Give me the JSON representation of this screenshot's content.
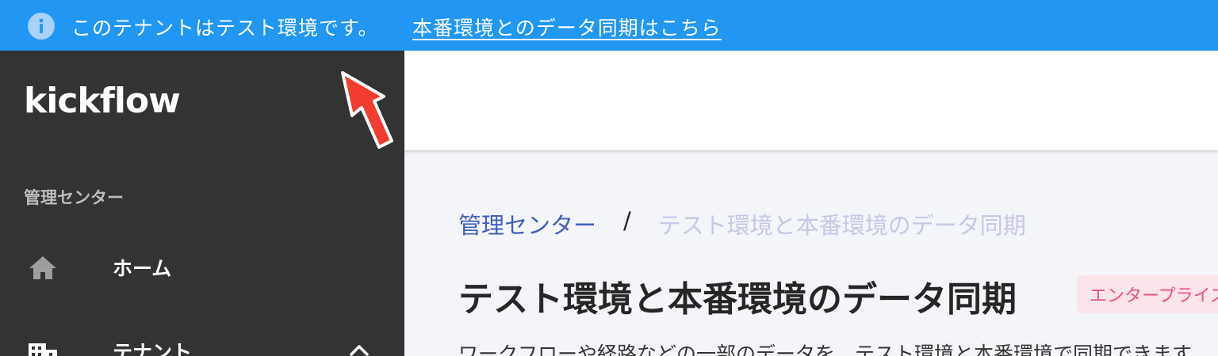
{
  "banner": {
    "icon": "info-icon",
    "message": "このテナントはテスト環境です。",
    "link_label": "本番環境とのデータ同期はこちら",
    "bg_color": "#2196f3"
  },
  "sidebar": {
    "logo": "kickflow",
    "section_label": "管理センター",
    "items": [
      {
        "icon": "home-icon",
        "label": "ホーム"
      },
      {
        "icon": "building-icon",
        "label": "テナント",
        "expanded": true
      }
    ]
  },
  "breadcrumb": {
    "root": "管理センター",
    "separator": "/",
    "current": "テスト環境と本番環境のデータ同期"
  },
  "page": {
    "title": "テスト環境と本番環境のデータ同期",
    "badge": "エンタープライズ",
    "description": "ワークフローや経路などの一部のデータを、テスト環境と本番環境で同期できます。"
  },
  "colors": {
    "sidebar_bg": "#333333",
    "accent_link": "#3f5fb8",
    "badge_text": "#e8577d",
    "annotation_arrow": "#f13c2f"
  }
}
